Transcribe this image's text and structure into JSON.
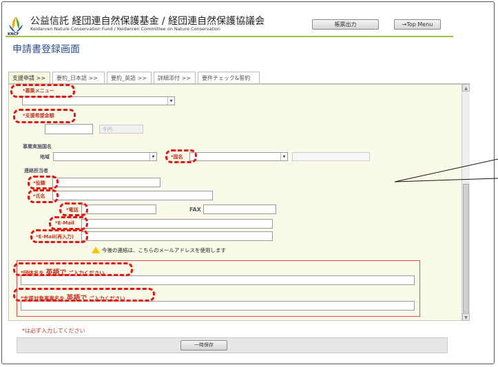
{
  "header": {
    "title": "公益信託 経団連自然保護基金 / 経団連自然保護協議会",
    "subtitle": "Keidanren Nature Conservation Fund / Keidanren Committee on Nature Conservation",
    "logo_text": "KNCF",
    "print_label": "帳票出力",
    "top_menu_label": "→Top Menu"
  },
  "page_title": "申請書登録画面",
  "tabs": [
    {
      "label": "支援申請 >>"
    },
    {
      "label": "要約_日本語 >>"
    },
    {
      "label": "要約_英語 >>"
    },
    {
      "label": "詳細添付 >>"
    },
    {
      "label": "要件チェック&誓約"
    }
  ],
  "form": {
    "menu_label": "*募集メニュー",
    "amount_label": "*支援希望金額",
    "amount_unit": "千円",
    "country_section_label": "事業実施国名",
    "region_label": "地域",
    "country_label": "*国名",
    "contact_section_label": "連絡担当者",
    "position_label": "*役職",
    "name_label": "*氏名",
    "phone_label": "*電話",
    "fax_label": "FAX",
    "email_label": "*E-Mail",
    "email_confirm_label": "*E-Mail(再入力)",
    "email_notice": "今後の連絡は、こちらのメールアドレスを使用します",
    "org_name_label_pre": "*団体名を",
    "org_name_label_em": "英語で",
    "org_name_label_post": "ご入力ください",
    "project_name_label_pre": "*支援対象事業名を",
    "project_name_label_em": "英語で",
    "project_name_label_post": "ご入力ください"
  },
  "required_note": "*は必ず入力してください",
  "save_label": "一時保存",
  "colors": {
    "accent_green": "#9cc33a",
    "title_blue": "#2c4f8c",
    "required_red": "#c0392b",
    "highlight_red": "#e8130f"
  }
}
